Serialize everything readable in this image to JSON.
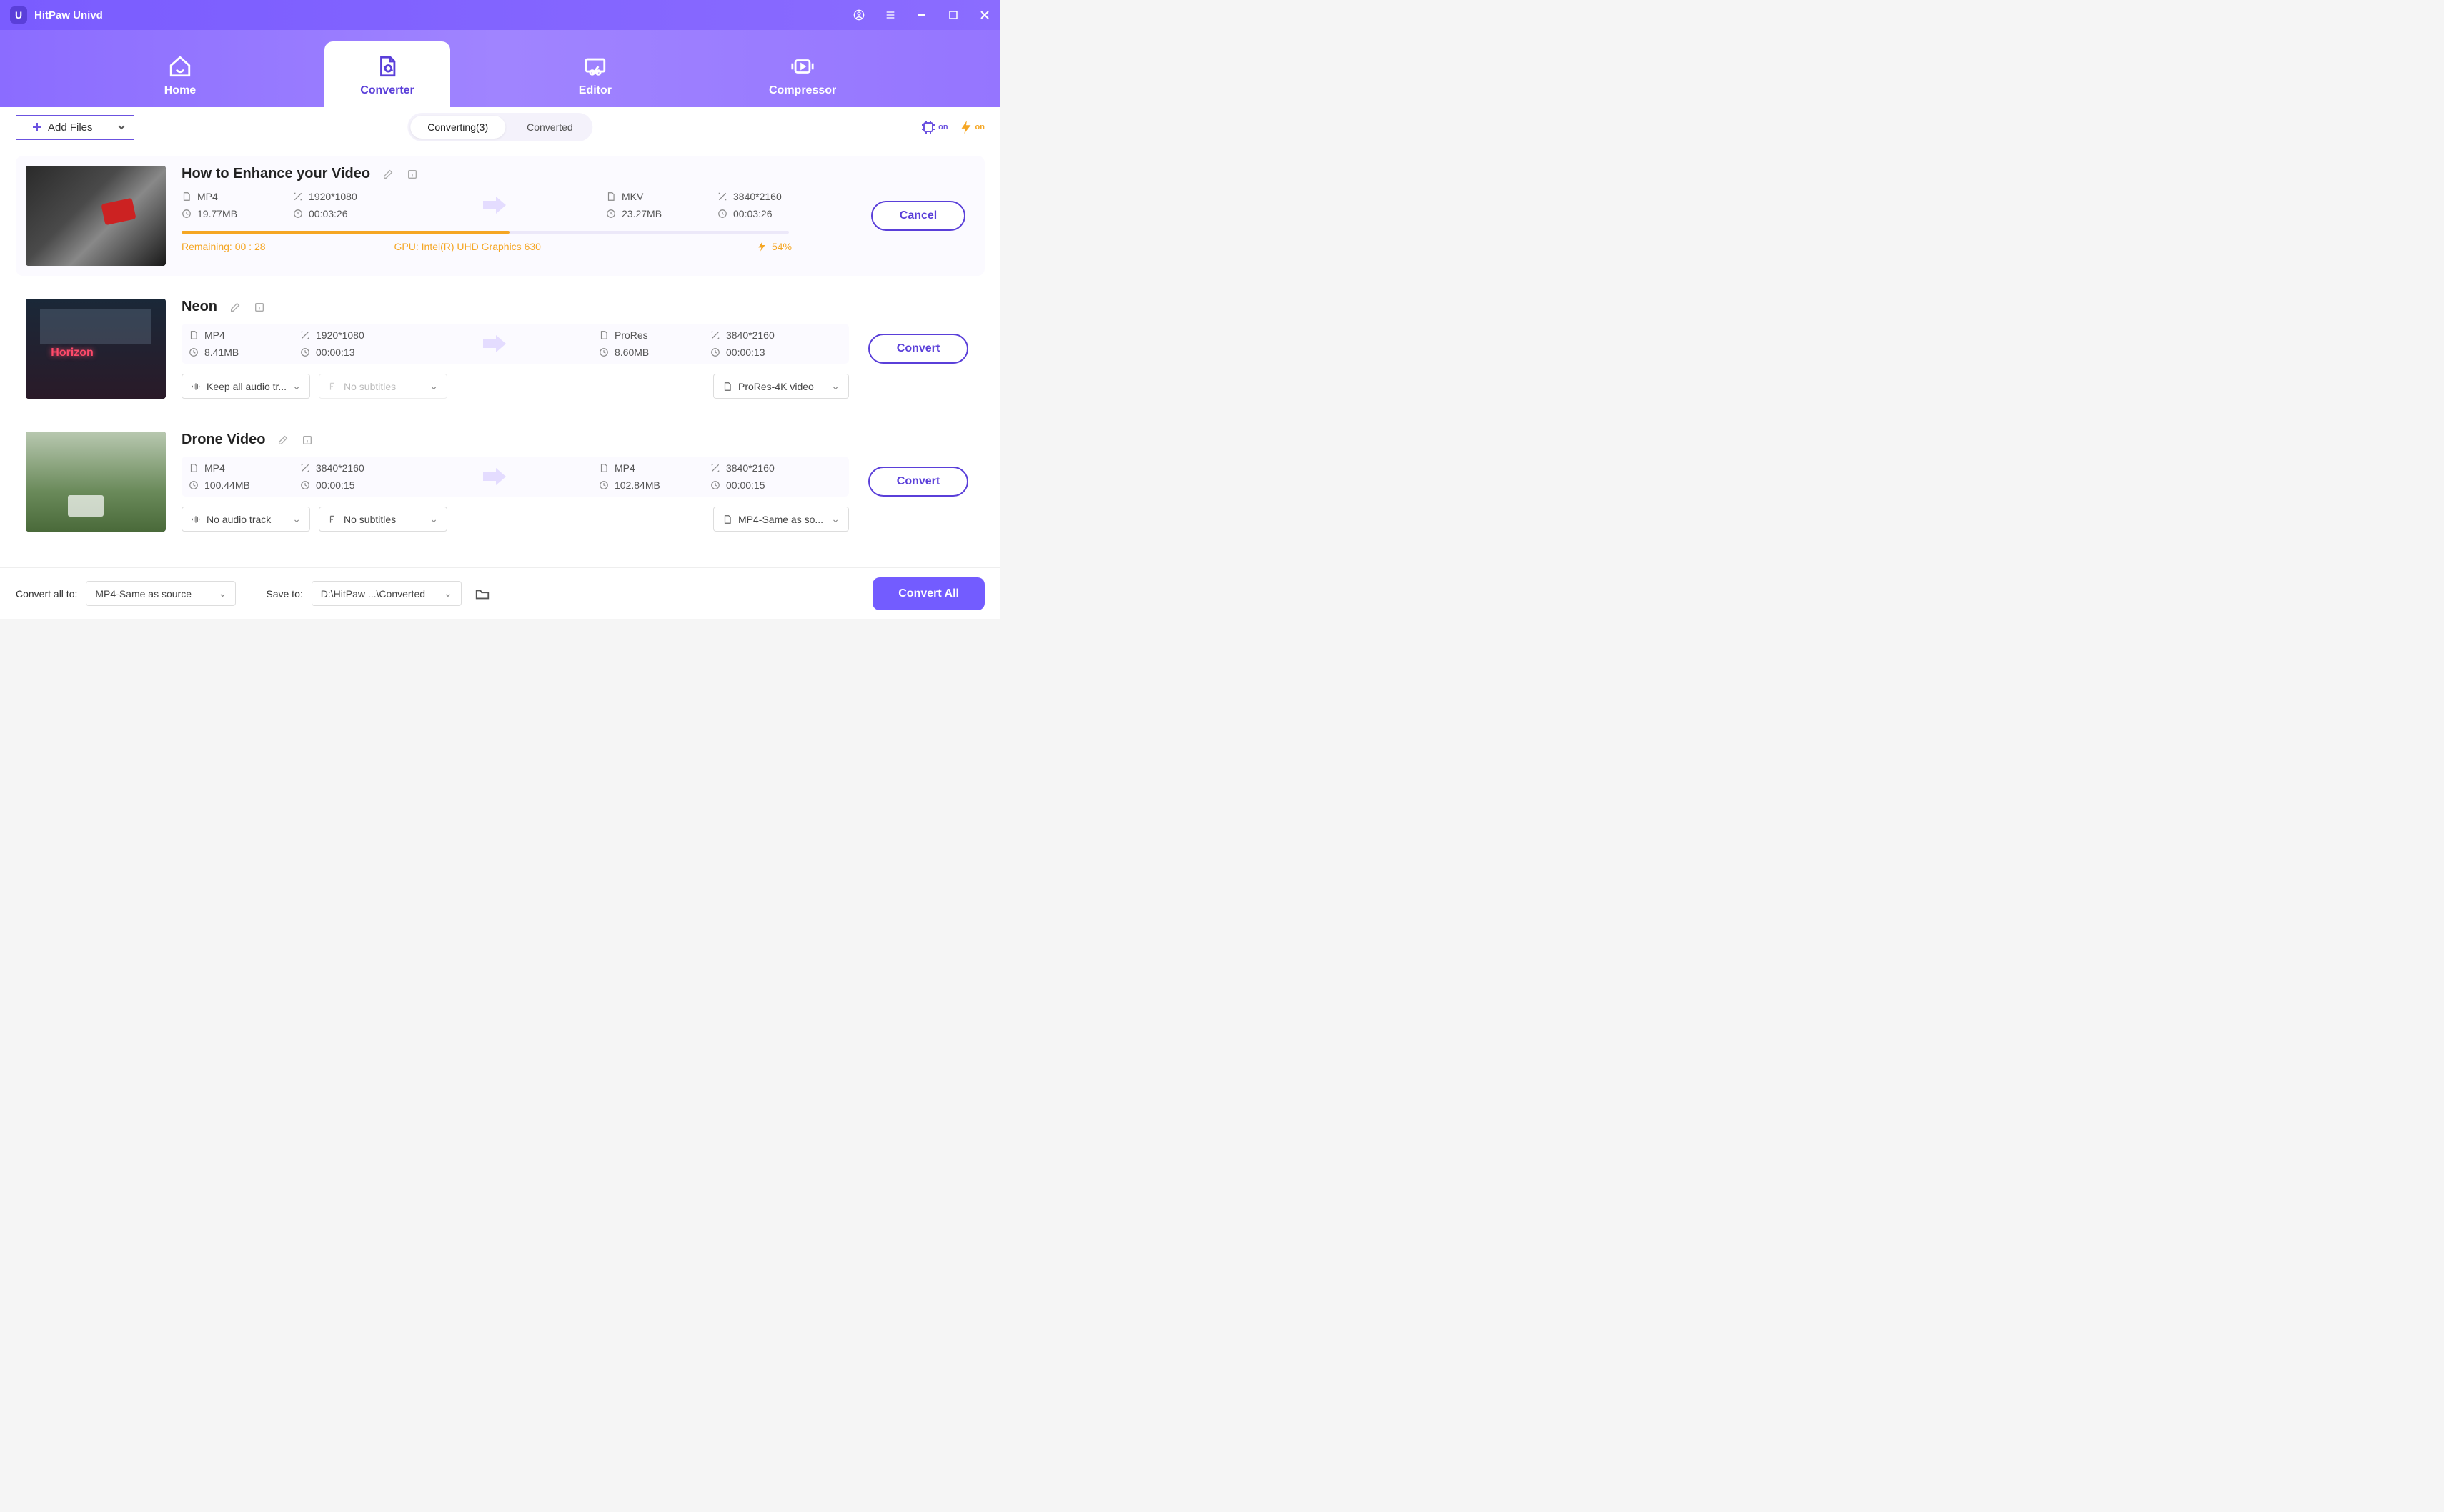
{
  "app": {
    "title": "HitPaw Univd"
  },
  "nav": {
    "home": "Home",
    "converter": "Converter",
    "editor": "Editor",
    "compressor": "Compressor"
  },
  "toolbar": {
    "add_files": "Add Files",
    "tab_converting": "Converting(3)",
    "tab_converted": "Converted",
    "gpu_on": "on",
    "bolt_on": "on"
  },
  "items": [
    {
      "title": "How to Enhance your Video",
      "src": {
        "format": "MP4",
        "resolution": "1920*1080",
        "size": "19.77MB",
        "duration": "00:03:26"
      },
      "dst": {
        "format": "MKV",
        "resolution": "3840*2160",
        "size": "23.27MB",
        "duration": "00:03:26"
      },
      "progress": {
        "remaining_label": "Remaining: 00 : 28",
        "gpu": "GPU: Intel(R) UHD Graphics 630",
        "percent": "54%",
        "fill_pct": 54
      },
      "action": "Cancel"
    },
    {
      "title": "Neon",
      "src": {
        "format": "MP4",
        "resolution": "1920*1080",
        "size": "8.41MB",
        "duration": "00:00:13"
      },
      "dst": {
        "format": "ProRes",
        "resolution": "3840*2160",
        "size": "8.60MB",
        "duration": "00:00:13"
      },
      "audio_select": "Keep all audio tr...",
      "subtitle_select": "No subtitles",
      "output_select": "ProRes-4K video",
      "action": "Convert"
    },
    {
      "title": "Drone Video",
      "src": {
        "format": "MP4",
        "resolution": "3840*2160",
        "size": "100.44MB",
        "duration": "00:00:15"
      },
      "dst": {
        "format": "MP4",
        "resolution": "3840*2160",
        "size": "102.84MB",
        "duration": "00:00:15"
      },
      "audio_select": "No audio track",
      "subtitle_select": "No subtitles",
      "output_select": "MP4-Same as so...",
      "action": "Convert"
    }
  ],
  "footer": {
    "convert_all_to_label": "Convert all to:",
    "convert_all_to_value": "MP4-Same as source",
    "save_to_label": "Save to:",
    "save_to_value": "D:\\HitPaw ...\\Converted",
    "convert_all_btn": "Convert All"
  }
}
